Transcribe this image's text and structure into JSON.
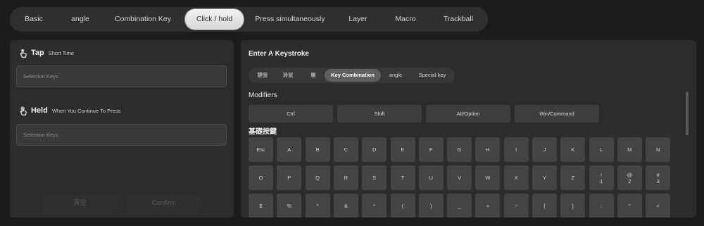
{
  "tabs": [
    "Basic",
    "angle",
    "Combination Key",
    "Click / hold",
    "Press simultaneously",
    "Layer",
    "Macro",
    "Trackball"
  ],
  "active_tab": "Click / hold",
  "tap": {
    "title": "Tap",
    "subtitle": "Short Time",
    "placeholder": "Selection Keys",
    "icon": "tap-hand-icon"
  },
  "held": {
    "title": "Held",
    "subtitle": "When You Continue To Press",
    "placeholder": "Selection Keys",
    "icon": "hold-hand-icon"
  },
  "left_buttons": {
    "clear": "清空",
    "confirm": "Confirm"
  },
  "keystroke": {
    "title": "Enter A Keystroke",
    "subtabs": [
      "鍵盤",
      "滑鼠",
      "層",
      "Key Combination",
      "angle",
      "Special-key"
    ],
    "active_subtab": "Key Combination",
    "modifiers_label": "Modifiers",
    "modifiers": [
      "Ctrl",
      "Shift",
      "Alt/Option",
      "Win/Command"
    ],
    "basic_keys_label": "基礎按鍵",
    "rows": [
      [
        [
          "Esc"
        ],
        [
          "A"
        ],
        [
          "B"
        ],
        [
          "C"
        ],
        [
          "D"
        ],
        [
          "E"
        ],
        [
          "F"
        ],
        [
          "G"
        ],
        [
          "H"
        ],
        [
          "I"
        ],
        [
          "J"
        ],
        [
          "K"
        ],
        [
          "L"
        ],
        [
          "M"
        ],
        [
          "N"
        ]
      ],
      [
        [
          "O"
        ],
        [
          "P"
        ],
        [
          "Q"
        ],
        [
          "R"
        ],
        [
          "S"
        ],
        [
          "T"
        ],
        [
          "U"
        ],
        [
          "V"
        ],
        [
          "W"
        ],
        [
          "X"
        ],
        [
          "Y"
        ],
        [
          "Z"
        ],
        [
          "!",
          "1"
        ],
        [
          "@",
          "2"
        ],
        [
          "#",
          "3"
        ]
      ],
      [
        [
          "$"
        ],
        [
          "%"
        ],
        [
          "^"
        ],
        [
          "&"
        ],
        [
          "*"
        ],
        [
          "("
        ],
        [
          ")"
        ],
        [
          "_"
        ],
        [
          "+"
        ],
        [
          "~"
        ],
        [
          "{"
        ],
        [
          "}"
        ],
        [
          ":"
        ],
        [
          "\""
        ],
        [
          "<"
        ]
      ]
    ]
  },
  "colors": {
    "background": "#1c1c1c",
    "panel": "#2c2c2c",
    "key": "#444444",
    "active_tab": "#e6e6e6"
  }
}
